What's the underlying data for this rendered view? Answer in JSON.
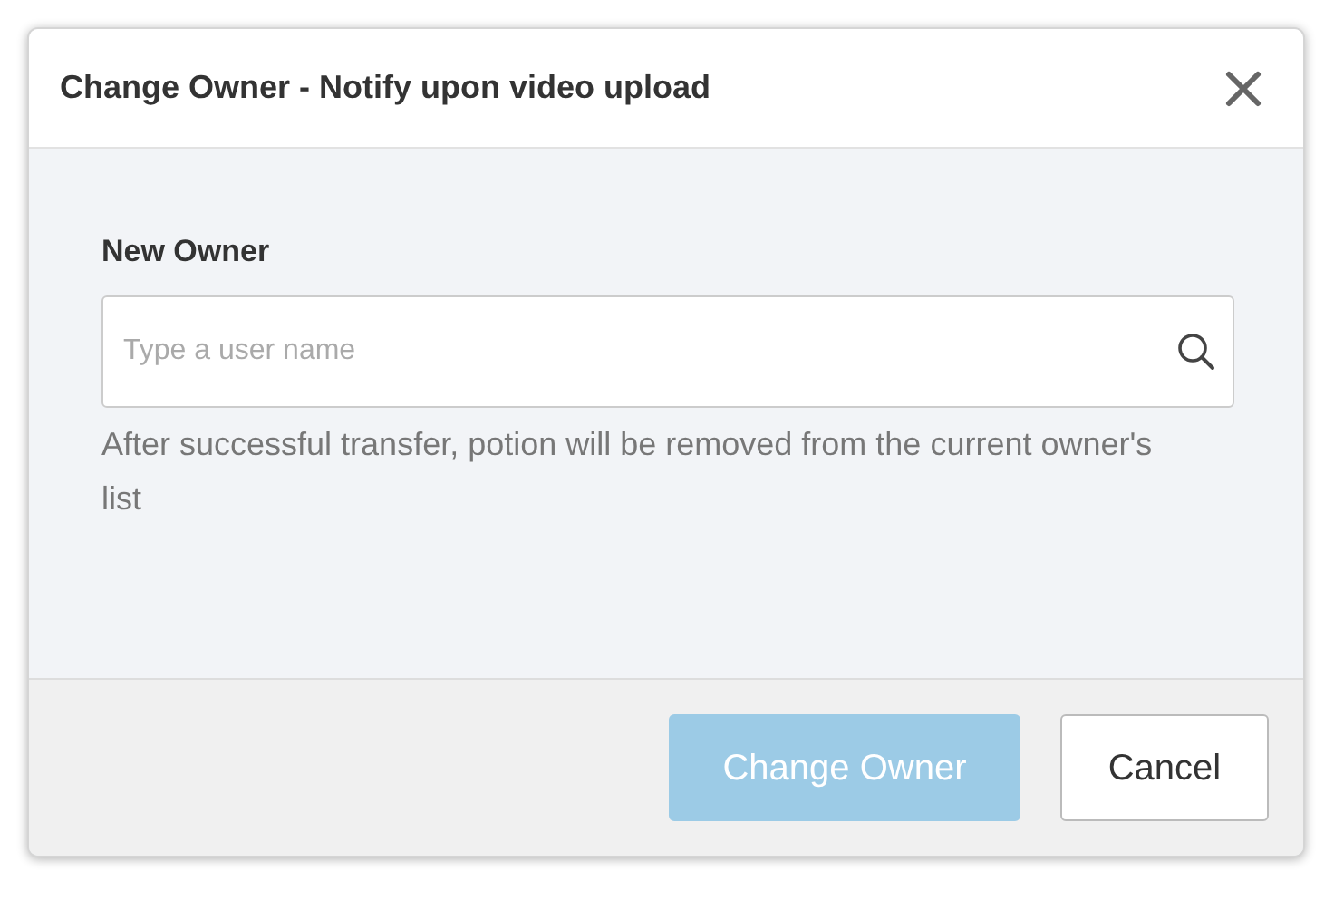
{
  "dialog": {
    "title": "Change Owner - Notify upon video upload"
  },
  "field": {
    "label": "New Owner",
    "placeholder": "Type a user name",
    "help": "After successful transfer, potion will be removed from the current owner's list"
  },
  "buttons": [
    {
      "label": "Change Owner",
      "kind": "primary",
      "disabled": true
    },
    {
      "label": "Cancel",
      "kind": "secondary",
      "disabled": false
    }
  ]
}
